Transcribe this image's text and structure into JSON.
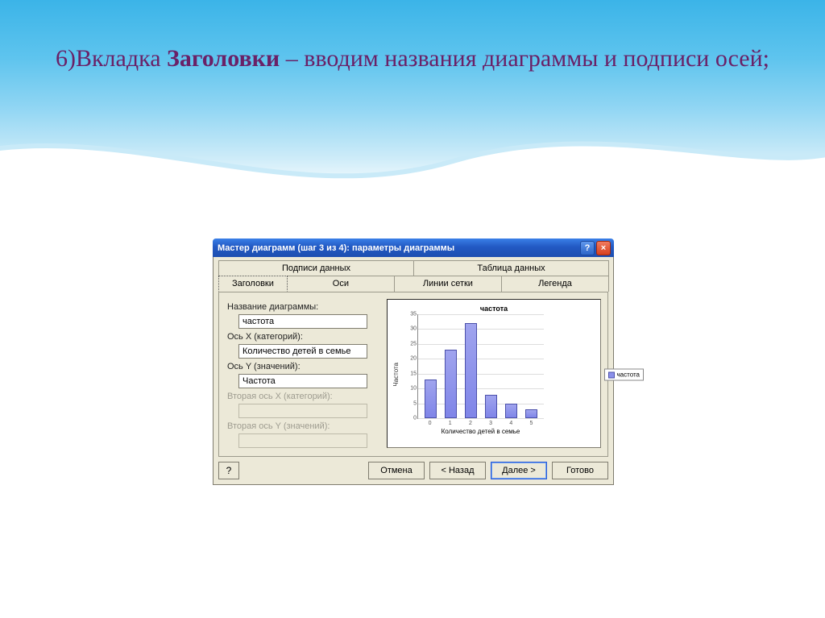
{
  "slide": {
    "text_prefix": "6)Вкладка ",
    "text_bold": "Заголовки",
    "text_suffix": " – вводим названия диаграммы и подписи осей;"
  },
  "dialog": {
    "title": "Мастер диаграмм (шаг 3 из 4): параметры диаграммы",
    "tabs_top": [
      "Подписи данных",
      "Таблица данных"
    ],
    "tabs_main": [
      "Заголовки",
      "Оси",
      "Линии сетки",
      "Легенда"
    ],
    "fields": {
      "chart_title_label": "Название диаграммы:",
      "chart_title_value": "частота",
      "x_axis_label": "Ось X (категорий):",
      "x_axis_value": "Количество детей в семье",
      "y_axis_label": "Ось Y (значений):",
      "y_axis_value": "Частота",
      "x2_axis_label": "Вторая ось X (категорий):",
      "x2_axis_value": "",
      "y2_axis_label": "Вторая ось Y (значений):",
      "y2_axis_value": ""
    },
    "buttons": {
      "cancel": "Отмена",
      "back": "< Назад",
      "next": "Далее >",
      "finish": "Готово"
    },
    "help_icon": "?",
    "close_icon": "×"
  },
  "chart_data": {
    "type": "bar",
    "title": "частота",
    "xlabel": "Количество детей в семье",
    "ylabel": "Частота",
    "categories": [
      "0",
      "1",
      "2",
      "3",
      "4",
      "5"
    ],
    "values": [
      13,
      23,
      32,
      8,
      5,
      3
    ],
    "ylim": [
      0,
      35
    ],
    "ytick_step": 5,
    "legend": [
      "частота"
    ]
  }
}
